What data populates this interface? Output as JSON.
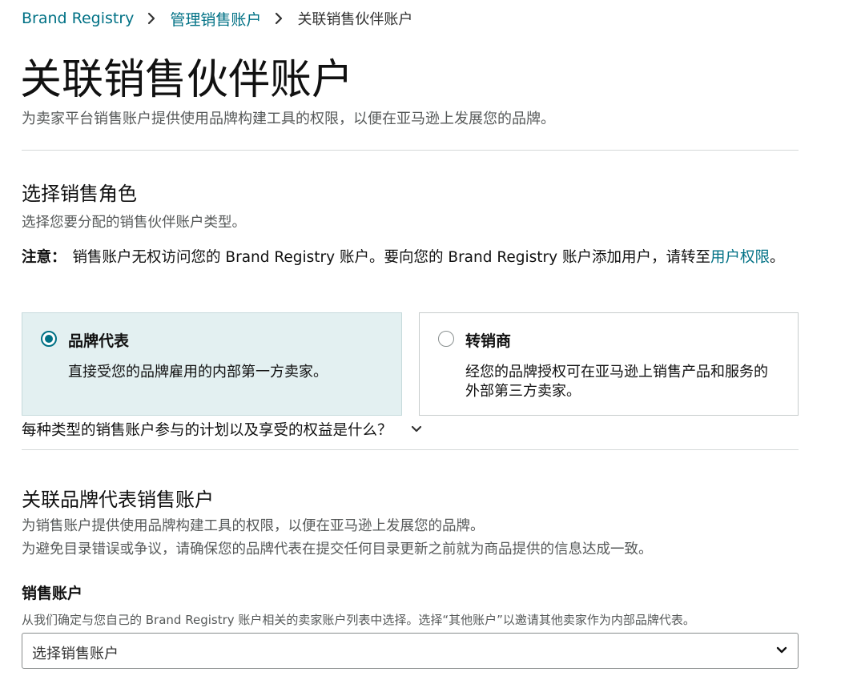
{
  "breadcrumb": {
    "items": [
      "Brand Registry",
      "管理销售账户"
    ],
    "current": "关联销售伙伴账户"
  },
  "page": {
    "title": "关联销售伙伴账户",
    "subtitle": "为卖家平台销售账户提供使用品牌构建工具的权限，以便在亚马逊上发展您的品牌。"
  },
  "role_section": {
    "title": "选择销售角色",
    "desc": "选择您要分配的销售伙伴账户类型。",
    "note_label": "注意：",
    "note_text": "销售账户无权访问您的 Brand Registry 账户。要向您的 Brand Registry 账户添加用户，请转至",
    "note_link": "用户权限",
    "note_end": "。",
    "options": [
      {
        "label": "品牌代表",
        "desc": "直接受您的品牌雇用的内部第一方卖家。",
        "selected": true
      },
      {
        "label": "转销商",
        "desc": "经您的品牌授权可在亚马逊上销售产品和服务的外部第三方卖家。",
        "selected": false
      }
    ],
    "faq": "每种类型的销售账户参与的计划以及享受的权益是什么？"
  },
  "link_section": {
    "title": "关联品牌代表销售账户",
    "desc1": "为销售账户提供使用品牌构建工具的权限，以便在亚马逊上发展您的品牌。",
    "desc2": "为避免目录错误或争议，请确保您的品牌代表在提交任何目录更新之前就为商品提供的信息达成一致。",
    "field_label": "销售账户",
    "field_hint": "从我们确定与您自己的 Brand Registry 账户相关的卖家账户列表中选择。选择“其他账户”以邀请其他卖家作为内部品牌代表。",
    "select_value": "选择销售账户"
  },
  "colors": {
    "link": "#007185",
    "selected_card_bg": "#e3f0f1",
    "muted_text": "#565959"
  },
  "icons": [
    "chevron-right-icon",
    "radio-checked-icon",
    "radio-unchecked-icon",
    "chevron-down-icon"
  ]
}
